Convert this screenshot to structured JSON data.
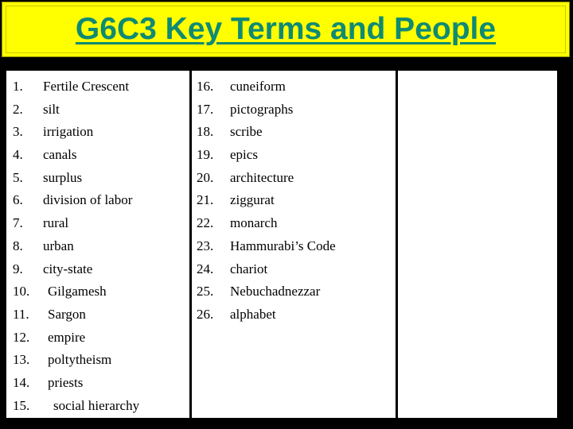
{
  "slide": {
    "title": "G6C3 Key Terms and People",
    "background_color": "#000000",
    "banner_color": "#FFFF00",
    "title_color": "#0F8A73"
  },
  "table": {
    "columns": [
      {
        "name": "terms-column-1",
        "items": [
          {
            "number": "1.",
            "label": "Fertile Crescent"
          },
          {
            "number": "2.",
            "label": "silt"
          },
          {
            "number": "3.",
            "label": "irrigation"
          },
          {
            "number": "4.",
            "label": "canals"
          },
          {
            "number": "5.",
            "label": "surplus"
          },
          {
            "number": "6.",
            "label": "division of labor"
          },
          {
            "number": "7.",
            "label": "rural"
          },
          {
            "number": "8.",
            "label": "urban"
          },
          {
            "number": "9.",
            "label": "city-state"
          },
          {
            "number": "10.",
            "label": "Gilgamesh"
          },
          {
            "number": "11.",
            "label": "Sargon"
          },
          {
            "number": "12.",
            "label": "empire"
          },
          {
            "number": "13.",
            "label": "poltytheism"
          },
          {
            "number": "14.",
            "label": "priests"
          },
          {
            "number": "15.",
            "label": "social hierarchy"
          }
        ]
      },
      {
        "name": "terms-column-2",
        "items": [
          {
            "number": "16.",
            "label": "cuneiform"
          },
          {
            "number": "17.",
            "label": "pictographs"
          },
          {
            "number": "18.",
            "label": "scribe"
          },
          {
            "number": "19.",
            "label": "epics"
          },
          {
            "number": "20.",
            "label": "architecture"
          },
          {
            "number": "21.",
            "label": "ziggurat"
          },
          {
            "number": "22.",
            "label": "monarch"
          },
          {
            "number": "23.",
            "label": "Hammurabi’s Code"
          },
          {
            "number": "24.",
            "label": "chariot"
          },
          {
            "number": "25.",
            "label": "Nebuchadnezzar"
          },
          {
            "number": "26.",
            "label": "alphabet"
          }
        ]
      },
      {
        "name": "terms-column-3",
        "items": []
      }
    ]
  }
}
